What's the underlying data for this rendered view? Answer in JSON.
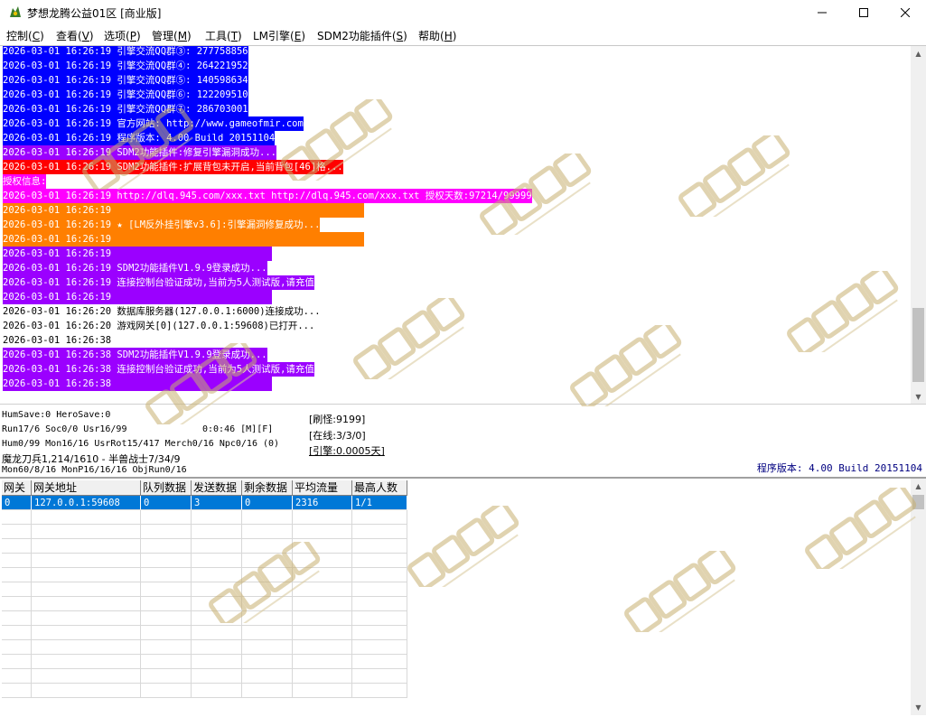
{
  "window": {
    "title": "梦想龙腾公益01区 [商业版]",
    "min_label": "─",
    "max_label": "☐",
    "close_label": "✕"
  },
  "menu": [
    {
      "label": "控制(",
      "key": "C",
      "end": ")"
    },
    {
      "label": "查看(",
      "key": "V",
      "end": ")"
    },
    {
      "label": "选项(",
      "key": "P",
      "end": ")"
    },
    {
      "label": "管理(",
      "key": "M",
      "end": ")"
    },
    {
      "label": "工具(",
      "key": "T",
      "end": ")"
    },
    {
      "label": "LM引擎(",
      "key": "E",
      "end": ")"
    },
    {
      "label": "SDM2功能插件(",
      "key": "S",
      "end": ")"
    },
    {
      "label": "帮助(",
      "key": "H",
      "end": ")"
    }
  ],
  "log": [
    {
      "text": "2026-03-01 16:26:19 引擎交流QQ群③: 277758856",
      "bg": "#0000ff",
      "fg": "#ffffff"
    },
    {
      "text": "2026-03-01 16:26:19 引擎交流QQ群④: 264221952",
      "bg": "#0000ff",
      "fg": "#ffffff"
    },
    {
      "text": "2026-03-01 16:26:19 引擎交流QQ群⑤: 140598634",
      "bg": "#0000ff",
      "fg": "#ffffff"
    },
    {
      "text": "2026-03-01 16:26:19 引擎交流QQ群⑥: 122209510",
      "bg": "#0000ff",
      "fg": "#ffffff"
    },
    {
      "text": "2026-03-01 16:26:19 引擎交流QQ群⑦: 286703001",
      "bg": "#0000ff",
      "fg": "#ffffff"
    },
    {
      "text": "2026-03-01 16:26:19 官方网站: http://www.gameofmir.com",
      "bg": "#0000ff",
      "fg": "#ffffff"
    },
    {
      "text": "2026-03-01 16:26:19 程序版本: 4.00 Build 20151104",
      "bg": "#0000ff",
      "fg": "#ffffff"
    },
    {
      "text": "2026-03-01 16:26:19 SDM2功能插件:修复引擎漏洞成功...",
      "bg": "#9b00ff",
      "fg": "#ffffff"
    },
    {
      "text": "2026-03-01 16:26:19 SDM2功能插件:扩展背包未开启,当前背包[46]格...",
      "bg": "#ff0000",
      "fg": "#ffffff"
    },
    {
      "text": "授权信息:",
      "bg": "#ff00ff",
      "fg": "#ffffff"
    },
    {
      "text": "2026-03-01 16:26:19 http://dlq.945.com/xxx.txt http://dlq.945.com/xxx.txt 授权天数:97214/99999",
      "bg": "#ff00ff",
      "fg": "#ffffff"
    },
    {
      "text": "2026-03-01 16:26:19",
      "bg": "#ff7f00",
      "fg": "#ffffff",
      "pad": 400
    },
    {
      "text": "2026-03-01 16:26:19 ★ [LM反外挂引擎v3.6]:引擎漏洞修复成功...",
      "bg": "#ff7f00",
      "fg": "#ffffff"
    },
    {
      "text": "2026-03-01 16:26:19",
      "bg": "#ff7f00",
      "fg": "#ffffff",
      "pad": 400
    },
    {
      "text": "2026-03-01 16:26:19",
      "bg": "#9b00ff",
      "fg": "#ffffff",
      "pad": 298
    },
    {
      "text": "2026-03-01 16:26:19 SDM2功能插件V1.9.9登录成功...",
      "bg": "#9b00ff",
      "fg": "#ffffff"
    },
    {
      "text": "2026-03-01 16:26:19 连接控制台验证成功,当前为5人测试版,请充值",
      "bg": "#9b00ff",
      "fg": "#ffffff"
    },
    {
      "text": "2026-03-01 16:26:19",
      "bg": "#9b00ff",
      "fg": "#ffffff",
      "pad": 298
    },
    {
      "text": "2026-03-01 16:26:20 数据库服务器(127.0.0.1:6000)连接成功...",
      "bg": "",
      "fg": "#000000"
    },
    {
      "text": "2026-03-01 16:26:20 游戏网关[0](127.0.0.1:59608)已打开...",
      "bg": "",
      "fg": "#000000"
    },
    {
      "text": "2026-03-01 16:26:38",
      "bg": "",
      "fg": "#000000",
      "pad": 298
    },
    {
      "text": "2026-03-01 16:26:38 SDM2功能插件V1.9.9登录成功...",
      "bg": "#9b00ff",
      "fg": "#ffffff"
    },
    {
      "text": "2026-03-01 16:26:38 连接控制台验证成功,当前为5人测试版,请充值",
      "bg": "#9b00ff",
      "fg": "#ffffff"
    },
    {
      "text": "2026-03-01 16:26:38",
      "bg": "#9b00ff",
      "fg": "#ffffff",
      "pad": 298
    }
  ],
  "status": {
    "line1": "HumSave:0 HeroSave:0",
    "line2a": "Run17/6 Soc0/0 Usr16/99",
    "line2b": "0:0:46 [M][F]",
    "line3": "Hum0/99 Mon16/16 UsrRot15/417 Merch0/16 Npc0/16 (0)",
    "line4": "魔龙刀兵1,214/1610 - 半兽战士7/34/9",
    "line5": "Mon60/8/16 MonP16/16/16 ObjRun0/16",
    "refresh": "[刷怪:9199]",
    "online": "[在线:3/3/0]",
    "engine": "[引擎:0.0005天]",
    "version": "程序版本: 4.00 Build 20151104"
  },
  "grid": {
    "columns": [
      "网关",
      "网关地址",
      "队列数据",
      "发送数据",
      "剩余数据",
      "平均流量",
      "最高人数"
    ],
    "rows": [
      [
        "0",
        "127.0.0.1:59608",
        "0",
        "3",
        "0",
        "2316",
        "1/1"
      ]
    ],
    "empty_rows": 13
  },
  "colors": {
    "blue": "#0000ff",
    "purple": "#9b00ff",
    "red": "#ff0000",
    "magenta": "#ff00ff",
    "orange": "#ff7f00",
    "selection": "#0078d7"
  }
}
